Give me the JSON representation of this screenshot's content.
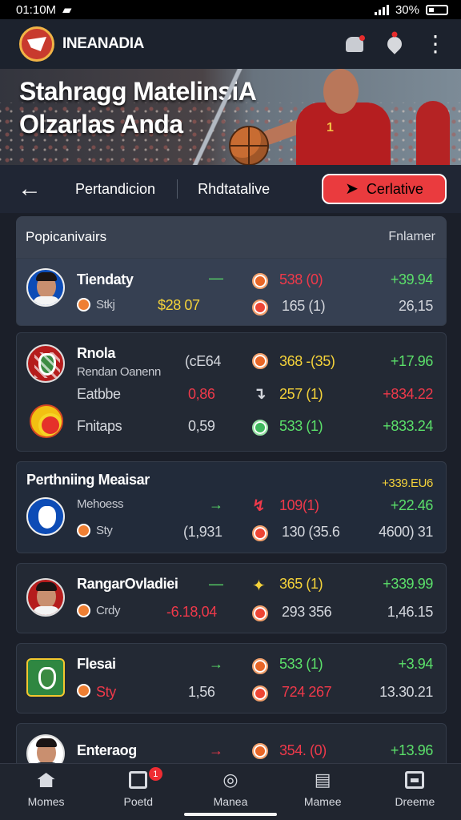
{
  "status": {
    "time": "01:10M",
    "battery": "30%"
  },
  "app": {
    "title": "INEANADIA"
  },
  "hero": {
    "line1": "Stahragg MatelinsiA",
    "line2": "Olzarlas Anda"
  },
  "filters": {
    "left": "Pertandicion",
    "middle": "Rhdtatalive",
    "primary": "Cerlative"
  },
  "table": {
    "title": "Popicanivairs",
    "right": "Fnlamer"
  },
  "rows": [
    {
      "name": "Tiendaty",
      "sub": "Stkj",
      "sub_value": "$28 07",
      "dash": "—",
      "value1": "538 (0)",
      "value2": "165 (1)",
      "right1": "+39.94",
      "right2": "26,15",
      "colors": {
        "value1": "#ef394a",
        "right1": "#5be06a"
      }
    },
    {
      "name": "Rnola",
      "sub": "Rendan Oanenn",
      "sub2": "Eatbbe",
      "sub3": "Fnitaps",
      "value_a": "(cE64",
      "value_b": "0,86",
      "value_c": "0,59",
      "value1": "368 -(35)",
      "value2": "257 (1)",
      "value3": "533 (1)",
      "right1": "+17.96",
      "right2": "+834.22",
      "right3": "+833.24",
      "colors": {
        "value1": "#f4d23a",
        "value2": "#f4d23a",
        "value3": "#5be06a"
      }
    },
    {
      "name": "Perthniing Meaisar",
      "sub": "Mehoess",
      "sub2": "Sty",
      "value_a": "(1,931",
      "value1": "109(1)",
      "value2": "130 (35.6",
      "right_top": "+339.EU6",
      "right1": "+22.46",
      "right2": "4600) 31"
    },
    {
      "name": "RangarOvladiei",
      "sub": "Crdy",
      "value_a": "-6.18,04",
      "value1": "365 (1)",
      "value2": "293 356",
      "right1": "+339.99",
      "right2": "1,46.15"
    },
    {
      "name": "Flesai",
      "sub": "Sty",
      "value_a": "1,56",
      "value1": "533 (1)",
      "value2": "724 267",
      "right1": "+3.94",
      "right2": "13.30.21"
    },
    {
      "name": "Enteraog",
      "value1": "354. (0)",
      "right1": "+13.96"
    }
  ],
  "tabs": [
    {
      "label": "Momes",
      "icon": "home-icon"
    },
    {
      "label": "Poetd",
      "icon": "notification-icon",
      "badge": "1"
    },
    {
      "label": "Manea",
      "icon": "map-pin-icon"
    },
    {
      "label": "Mamee",
      "icon": "document-icon"
    },
    {
      "label": "Dreeme",
      "icon": "square-icon"
    }
  ]
}
